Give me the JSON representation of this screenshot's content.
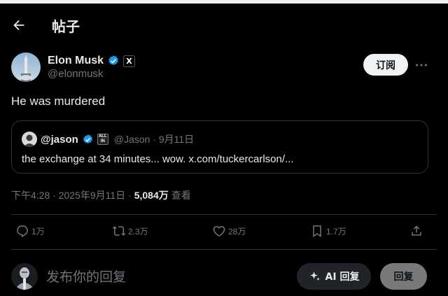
{
  "header": {
    "title": "帖子"
  },
  "author": {
    "name": "Elon Musk",
    "handle": "@elonmusk",
    "badge": "X"
  },
  "subscribe_label": "订阅",
  "tweet": {
    "text": "He was murdered"
  },
  "quote": {
    "name": "@jason",
    "badge_top": "ALL",
    "badge_bottom": "IN",
    "meta": "@Jason · 9月11日",
    "text": "the exchange at 34 minutes... wow. x.com/tuckercarlson/..."
  },
  "meta": {
    "time": "下午4:28 · 2025年9月11日 ·",
    "views": "5,084万",
    "views_label": "查看"
  },
  "actions": {
    "replies": "1万",
    "reposts": "2.3万",
    "likes": "28万",
    "bookmarks": "1.7万"
  },
  "reply": {
    "placeholder": "发布你的回复",
    "ai_label": "AI 回复",
    "button_label": "回复"
  },
  "colors": {
    "verified": "#1d9bf0",
    "background": "#000000",
    "muted": "#71767b"
  }
}
